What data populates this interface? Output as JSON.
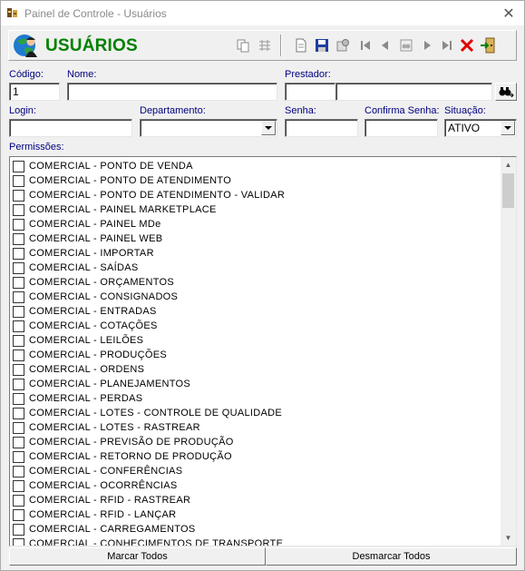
{
  "window": {
    "title": "Painel de Controle - Usuários",
    "close_label": "✕"
  },
  "header": {
    "heading": "USUÁRIOS"
  },
  "toolbar": {
    "buttons": [
      {
        "name": "copy-icon"
      },
      {
        "name": "grid-icon"
      },
      {
        "name": "new-record-icon"
      },
      {
        "name": "save-icon"
      },
      {
        "name": "cancel-edit-icon"
      },
      {
        "name": "first-record-icon"
      },
      {
        "name": "prior-record-icon"
      },
      {
        "name": "binoculars-icon"
      },
      {
        "name": "next-record-icon"
      },
      {
        "name": "last-record-icon"
      },
      {
        "name": "delete-icon"
      },
      {
        "name": "exit-icon"
      }
    ]
  },
  "form": {
    "codigo_label": "Código:",
    "codigo_value": "1",
    "nome_label": "Nome:",
    "nome_value": "",
    "prestador_label": "Prestador:",
    "prestador_code": "",
    "prestador_name": "",
    "login_label": "Login:",
    "login_value": "",
    "departamento_label": "Departamento:",
    "departamento_value": "",
    "senha_label": "Senha:",
    "senha_value": "",
    "confirma_label": "Confirma Senha:",
    "confirma_value": "",
    "situacao_label": "Situação:",
    "situacao_value": "ATIVO",
    "permissoes_label": "Permissões:"
  },
  "permissions": [
    "COMERCIAL - PONTO DE VENDA",
    "COMERCIAL - PONTO DE ATENDIMENTO",
    "COMERCIAL - PONTO DE ATENDIMENTO - VALIDAR",
    "COMERCIAL - PAINEL MARKETPLACE",
    "COMERCIAL - PAINEL MDe",
    "COMERCIAL - PAINEL WEB",
    "COMERCIAL - IMPORTAR",
    "COMERCIAL - SAÍDAS",
    "COMERCIAL - ORÇAMENTOS",
    "COMERCIAL - CONSIGNADOS",
    "COMERCIAL - ENTRADAS",
    "COMERCIAL - COTAÇÕES",
    "COMERCIAL - LEILÕES",
    "COMERCIAL - PRODUÇÕES",
    "COMERCIAL - ORDENS",
    "COMERCIAL - PLANEJAMENTOS",
    "COMERCIAL - PERDAS",
    "COMERCIAL - LOTES - CONTROLE DE QUALIDADE",
    "COMERCIAL - LOTES - RASTREAR",
    "COMERCIAL - PREVISÃO DE PRODUÇÃO",
    "COMERCIAL - RETORNO DE PRODUÇÃO",
    "COMERCIAL - CONFERÊNCIAS",
    "COMERCIAL - OCORRÊNCIAS",
    "COMERCIAL - RFID - RASTREAR",
    "COMERCIAL - RFID - LANÇAR",
    "COMERCIAL - CARREGAMENTOS",
    "COMERCIAL - CONHECIMENTOS DE TRANSPORTE"
  ],
  "buttons": {
    "mark_all": "Marcar Todos",
    "unmark_all": "Desmarcar Todos"
  }
}
